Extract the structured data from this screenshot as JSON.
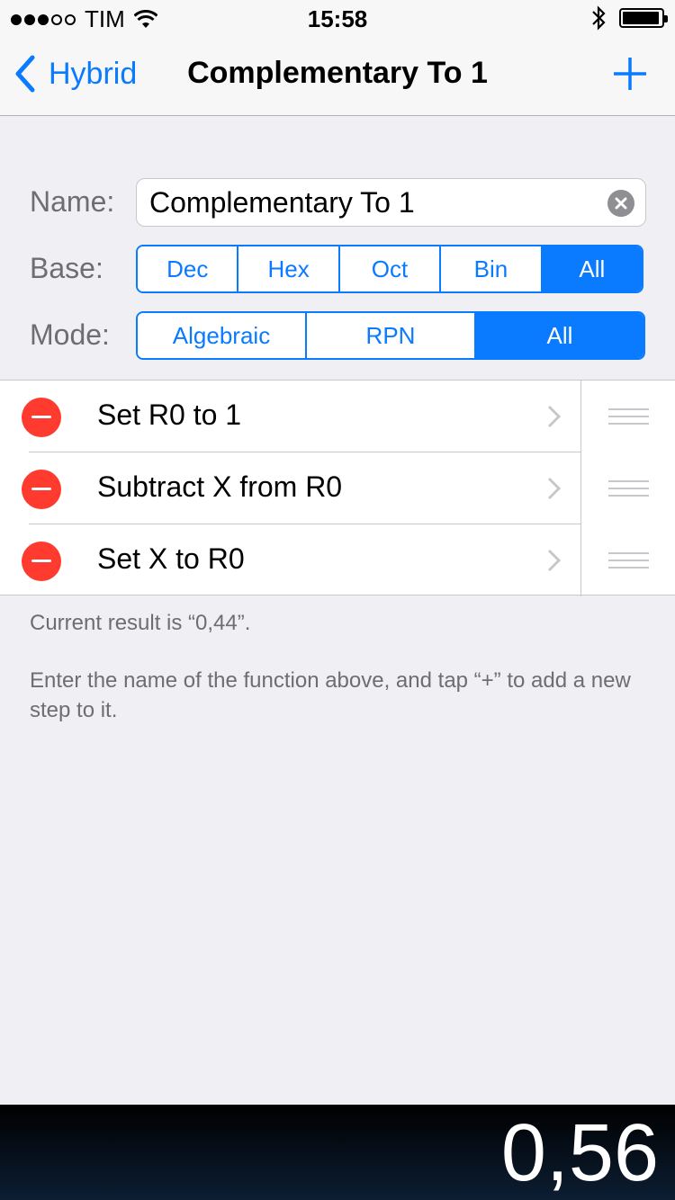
{
  "status_bar": {
    "carrier": "TIM",
    "time": "15:58",
    "signal_bars": 3,
    "signal_total": 5,
    "battery_level": 0.95
  },
  "nav": {
    "back_label": "Hybrid",
    "title": "Complementary To 1",
    "back_icon": "chevron-left-icon",
    "add_icon": "plus-icon"
  },
  "form": {
    "name_label": "Name:",
    "name_value": "Complementary To 1",
    "base_label": "Base:",
    "base_options": [
      "Dec",
      "Hex",
      "Oct",
      "Bin",
      "All"
    ],
    "base_selected": "All",
    "mode_label": "Mode:",
    "mode_options": [
      "Algebraic",
      "RPN",
      "All"
    ],
    "mode_selected": "All"
  },
  "steps": [
    {
      "label": "Set R0 to 1"
    },
    {
      "label": "Subtract X from R0"
    },
    {
      "label": "Set X to R0"
    }
  ],
  "footer": {
    "current_result": "Current result is “0,44”.",
    "hint": "Enter the name of the function above, and tap “+” to add a new step to it."
  },
  "display": {
    "value": "0,56"
  },
  "colors": {
    "accent": "#0a7aff",
    "delete": "#ff3b30",
    "background": "#efeff4"
  }
}
